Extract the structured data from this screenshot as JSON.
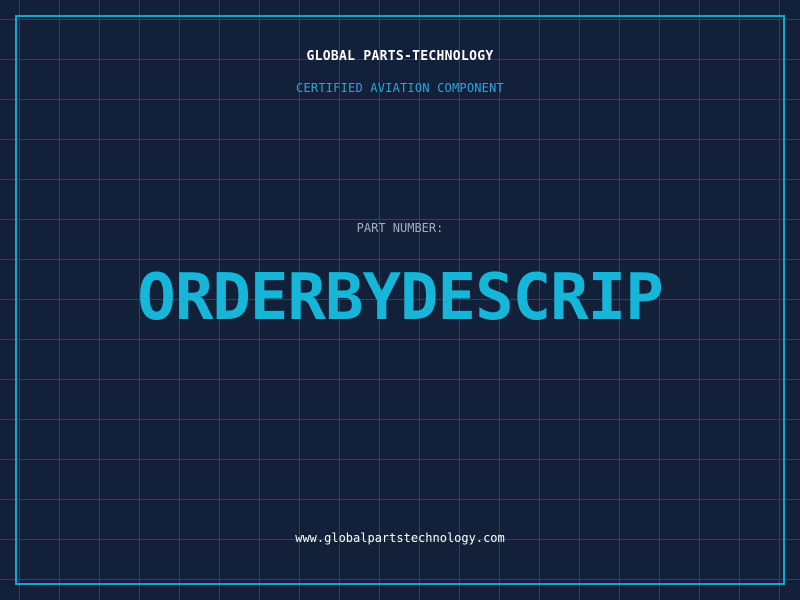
{
  "header": {
    "company_name": "GLOBAL PARTS-TECHNOLOGY",
    "subtitle": "CERTIFIED AVIATION COMPONENT"
  },
  "part": {
    "label": "PART NUMBER:",
    "number": "ORDERBYDESCRIP"
  },
  "footer": {
    "website": "www.globalpartstechnology.com"
  },
  "colors": {
    "background": "#13203a",
    "grid": "#1d4a5e",
    "accent": "#11a9d0",
    "part_number": "#16b6d9",
    "text": "#ffffff",
    "muted": "#a5acc0"
  }
}
